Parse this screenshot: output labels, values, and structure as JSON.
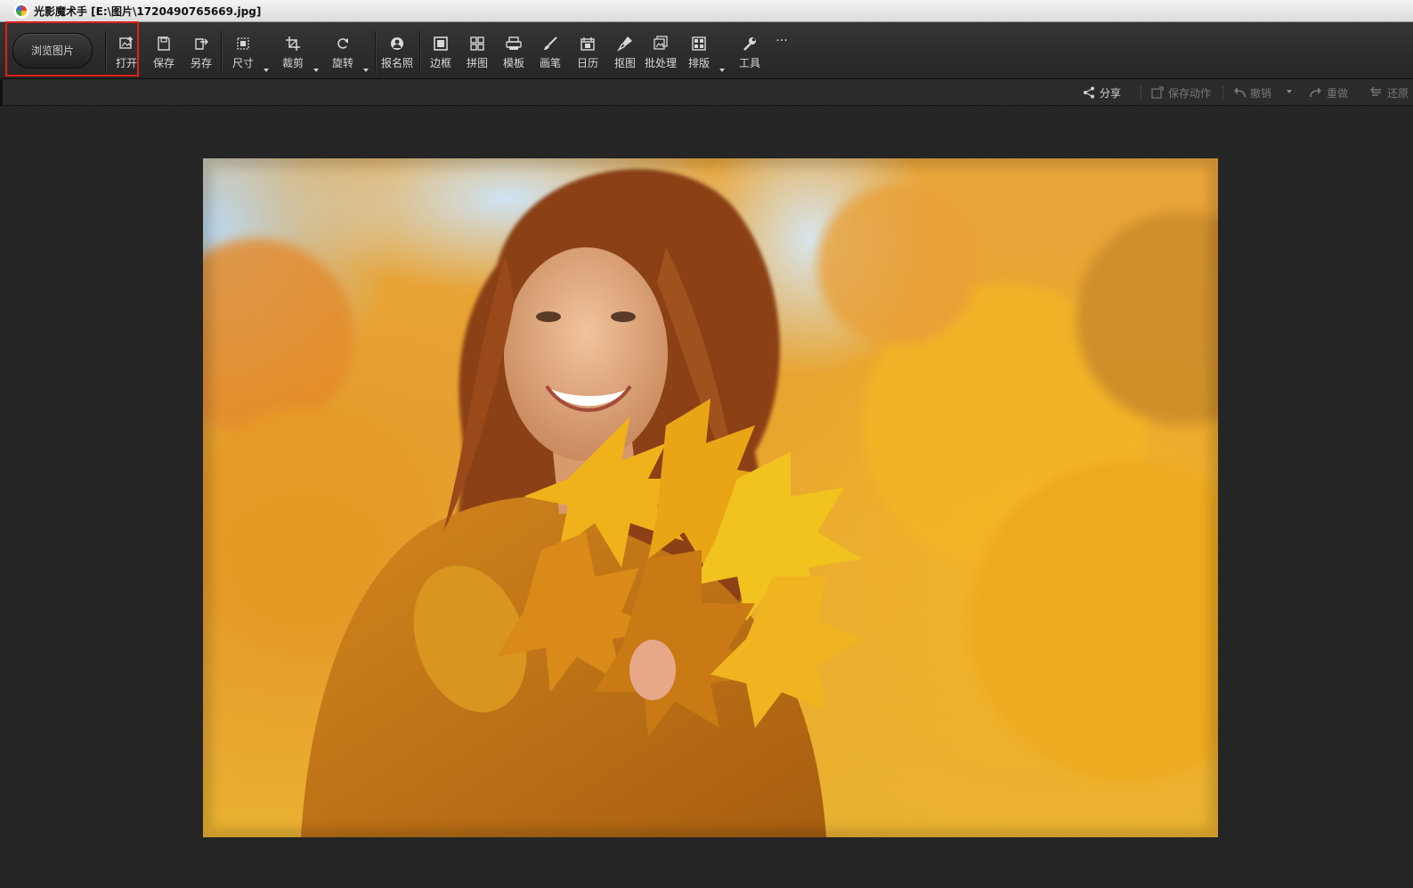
{
  "window": {
    "title": "光影魔术手 [E:\\图片\\1720490765669.jpg]"
  },
  "toolbar": {
    "browse_label": "浏览图片",
    "tools": [
      {
        "id": "open",
        "label": "打开",
        "icon": "open-image-icon"
      },
      {
        "id": "save",
        "label": "保存",
        "icon": "save-icon"
      },
      {
        "id": "saveas",
        "label": "另存",
        "icon": "save-as-icon"
      },
      {
        "id": "size",
        "label": "尺寸",
        "icon": "resize-icon"
      },
      {
        "id": "crop",
        "label": "裁剪",
        "icon": "crop-icon"
      },
      {
        "id": "rotate",
        "label": "旋转",
        "icon": "rotate-icon"
      },
      {
        "id": "idphoto",
        "label": "报名照",
        "icon": "id-photo-icon"
      },
      {
        "id": "border",
        "label": "边框",
        "icon": "border-icon"
      },
      {
        "id": "collage",
        "label": "拼图",
        "icon": "collage-icon"
      },
      {
        "id": "template",
        "label": "模板",
        "icon": "template-icon"
      },
      {
        "id": "brush",
        "label": "画笔",
        "icon": "brush-icon"
      },
      {
        "id": "calendar",
        "label": "日历",
        "icon": "calendar-icon"
      },
      {
        "id": "cutout",
        "label": "抠图",
        "icon": "cutout-icon"
      },
      {
        "id": "batch",
        "label": "批处理",
        "icon": "batch-icon"
      },
      {
        "id": "layout",
        "label": "排版",
        "icon": "layout-icon"
      },
      {
        "id": "tools",
        "label": "工具",
        "icon": "wrench-icon"
      }
    ],
    "more_label": "···"
  },
  "actionbar": {
    "share": "分享",
    "save_action": "保存动作",
    "undo": "撤销",
    "redo": "重做",
    "restore": "还原"
  },
  "colors": {
    "toolbar_bg": "#2e2e2e",
    "canvas_bg": "#242424",
    "highlight": "#e0201b"
  }
}
